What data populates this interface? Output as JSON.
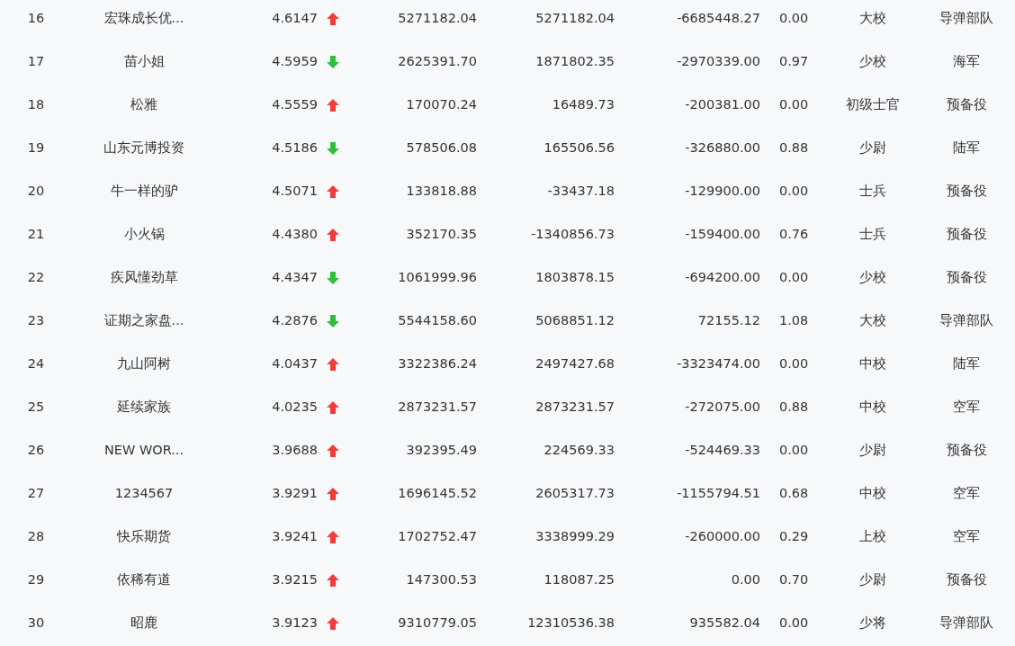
{
  "rows": [
    {
      "rank": "16",
      "name": "宏珠成长优...",
      "score": "4.6147",
      "kind": "up",
      "column_3": "5271182.04",
      "column_4": "5271182.04",
      "column_5": "-6685448.27",
      "column_6": "0.00",
      "rank_title": "大校",
      "branch": "导弹部队"
    },
    {
      "rank": "17",
      "name": "苗小姐",
      "score": "4.5959",
      "kind": "down",
      "column_3": "2625391.70",
      "column_4": "1871802.35",
      "column_5": "-2970339.00",
      "column_6": "0.97",
      "rank_title": "少校",
      "branch": "海军"
    },
    {
      "rank": "18",
      "name": "松雅",
      "score": "4.5559",
      "kind": "up",
      "column_3": "170070.24",
      "column_4": "16489.73",
      "column_5": "-200381.00",
      "column_6": "0.00",
      "rank_title": "初级士官",
      "branch": "预备役"
    },
    {
      "rank": "19",
      "name": "山东元博投资",
      "score": "4.5186",
      "kind": "down",
      "column_3": "578506.08",
      "column_4": "165506.56",
      "column_5": "-326880.00",
      "column_6": "0.88",
      "rank_title": "少尉",
      "branch": "陆军"
    },
    {
      "rank": "20",
      "name": "牛一样的驴",
      "score": "4.5071",
      "kind": "up",
      "column_3": "133818.88",
      "column_4": "-33437.18",
      "column_5": "-129900.00",
      "column_6": "0.00",
      "rank_title": "士兵",
      "branch": "预备役"
    },
    {
      "rank": "21",
      "name": "小火锅",
      "score": "4.4380",
      "kind": "up",
      "column_3": "352170.35",
      "column_4": "-1340856.73",
      "column_5": "-159400.00",
      "column_6": "0.76",
      "rank_title": "士兵",
      "branch": "预备役"
    },
    {
      "rank": "22",
      "name": "疾风懂劲草",
      "score": "4.4347",
      "kind": "down",
      "column_3": "1061999.96",
      "column_4": "1803878.15",
      "column_5": "-694200.00",
      "column_6": "0.00",
      "rank_title": "少校",
      "branch": "预备役"
    },
    {
      "rank": "23",
      "name": "证期之家盘...",
      "score": "4.2876",
      "kind": "down",
      "column_3": "5544158.60",
      "column_4": "5068851.12",
      "column_5": "72155.12",
      "column_6": "1.08",
      "rank_title": "大校",
      "branch": "导弹部队"
    },
    {
      "rank": "24",
      "name": "九山阿树",
      "score": "4.0437",
      "kind": "up",
      "column_3": "3322386.24",
      "column_4": "2497427.68",
      "column_5": "-3323474.00",
      "column_6": "0.00",
      "rank_title": "中校",
      "branch": "陆军"
    },
    {
      "rank": "25",
      "name": "延续家族",
      "score": "4.0235",
      "kind": "up",
      "column_3": "2873231.57",
      "column_4": "2873231.57",
      "column_5": "-272075.00",
      "column_6": "0.88",
      "rank_title": "中校",
      "branch": "空军"
    },
    {
      "rank": "26",
      "name": "NEW WOR...",
      "score": "3.9688",
      "kind": "up",
      "column_3": "392395.49",
      "column_4": "224569.33",
      "column_5": "-524469.33",
      "column_6": "0.00",
      "rank_title": "少尉",
      "branch": "预备役"
    },
    {
      "rank": "27",
      "name": "1234567",
      "score": "3.9291",
      "kind": "up",
      "column_3": "1696145.52",
      "column_4": "2605317.73",
      "column_5": "-1155794.51",
      "column_6": "0.68",
      "rank_title": "中校",
      "branch": "空军"
    },
    {
      "rank": "28",
      "name": "快乐期货",
      "score": "3.9241",
      "kind": "up",
      "column_3": "1702752.47",
      "column_4": "3338999.29",
      "column_5": "-260000.00",
      "column_6": "0.29",
      "rank_title": "上校",
      "branch": "空军"
    },
    {
      "rank": "29",
      "name": "依稀有道",
      "score": "3.9215",
      "kind": "up",
      "column_3": "147300.53",
      "column_4": "118087.25",
      "column_5": "0.00",
      "column_6": "0.70",
      "rank_title": "少尉",
      "branch": "预备役"
    },
    {
      "rank": "30",
      "name": "昭鹿",
      "score": "3.9123",
      "kind": "up",
      "column_3": "9310779.05",
      "column_4": "12310536.38",
      "column_5": "935582.04",
      "column_6": "0.00",
      "rank_title": "少将",
      "branch": "导弹部队"
    }
  ]
}
